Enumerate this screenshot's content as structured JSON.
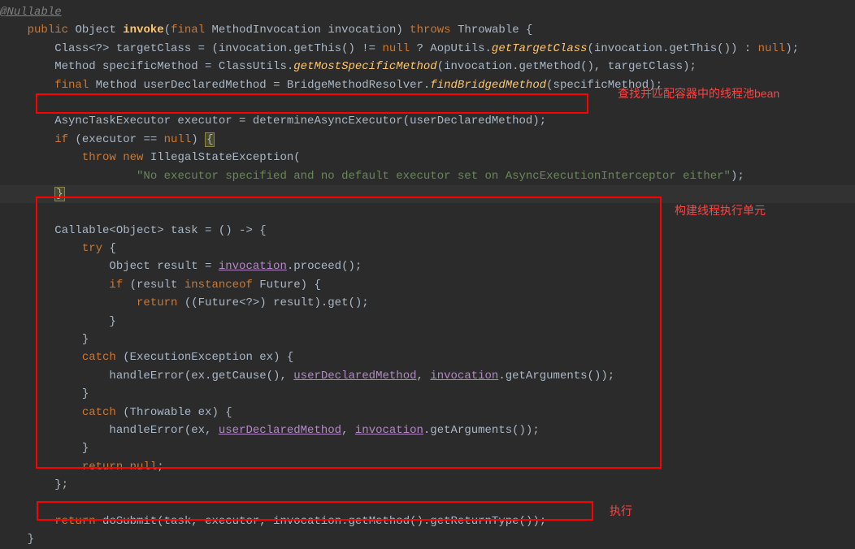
{
  "annotations": {
    "label1": "查找并匹配容器中的线程池bean",
    "label2": "构建线程执行单元",
    "label3": "执行"
  },
  "code": {
    "l0a": "@Nullable",
    "l1_pre": "    ",
    "l1_kw1": "public",
    "l1_sp1": " ",
    "l1_type1": "Object",
    "l1_sp2": " ",
    "l1_method": "invoke",
    "l1_paren1": "(",
    "l1_kw2": "final",
    "l1_sp3": " ",
    "l1_type2": "MethodInvocation invocation",
    "l1_paren2": ") ",
    "l1_kw3": "throws",
    "l1_rest": " Throwable {",
    "l2_pre": "        Class<?> targetClass = (invocation.getThis() != ",
    "l2_kw1": "null",
    "l2_mid1": " ? AopUtils.",
    "l2_sm1": "getTargetClass",
    "l2_mid2": "(invocation.getThis()) : ",
    "l2_kw2": "null",
    "l2_end": ");",
    "l3_pre": "        Method specificMethod = ClassUtils.",
    "l3_sm": "getMostSpecificMethod",
    "l3_end": "(invocation.getMethod(), targetClass);",
    "l4_pre": "        ",
    "l4_kw": "final",
    "l4_mid1": " Method userDeclaredMethod = BridgeMethodResolver.",
    "l4_sm": "findBridgedMethod",
    "l4_end": "(specificMethod);",
    "l5": "",
    "l6": "        AsyncTaskExecutor executor = determineAsyncExecutor(userDeclaredMethod);",
    "l7_pre": "        ",
    "l7_kw": "if",
    "l7_mid": " (executor == ",
    "l7_kw2": "null",
    "l7_end": ") ",
    "l7_br": "{",
    "l8_pre": "            ",
    "l8_kw1": "throw",
    "l8_sp": " ",
    "l8_kw2": "new",
    "l8_end": " IllegalStateException(",
    "l9_pre": "                    ",
    "l9_str": "\"No executor specified and no default executor set on AsyncExecutionInterceptor either\"",
    "l9_end": ");",
    "l10_pre": "        ",
    "l10_br": "}",
    "l11": "",
    "l12": "        Callable<Object> task = () -> {",
    "l13_pre": "            ",
    "l13_kw": "try",
    "l13_end": " {",
    "l14_pre": "                Object result = ",
    "l14_u": "invocation",
    "l14_end": ".proceed();",
    "l15_pre": "                ",
    "l15_kw1": "if",
    "l15_mid1": " (result ",
    "l15_kw2": "instanceof",
    "l15_end": " Future) {",
    "l16_pre": "                    ",
    "l16_kw": "return",
    "l16_end": " ((Future<?>) result).get();",
    "l17": "                }",
    "l18": "            }",
    "l19_pre": "            ",
    "l19_kw": "catch",
    "l19_end": " (ExecutionException ex) {",
    "l20_pre": "                handleError(ex.getCause(), ",
    "l20_u1": "userDeclaredMethod",
    "l20_mid": ", ",
    "l20_u2": "invocation",
    "l20_end": ".getArguments());",
    "l21": "            }",
    "l22_pre": "            ",
    "l22_kw": "catch",
    "l22_end": " (Throwable ex) {",
    "l23_pre": "                handleError(ex, ",
    "l23_u1": "userDeclaredMethod",
    "l23_mid": ", ",
    "l23_u2": "invocation",
    "l23_end": ".getArguments());",
    "l24": "            }",
    "l25_pre": "            ",
    "l25_kw": "return",
    "l25_sp": " ",
    "l25_kw2": "null",
    "l25_end": ";",
    "l26": "        };",
    "l27": "",
    "l28_pre": "        ",
    "l28_kw": "return",
    "l28_end": " doSubmit(task, executor, invocation.getMethod().getReturnType());",
    "l29": "    }"
  }
}
